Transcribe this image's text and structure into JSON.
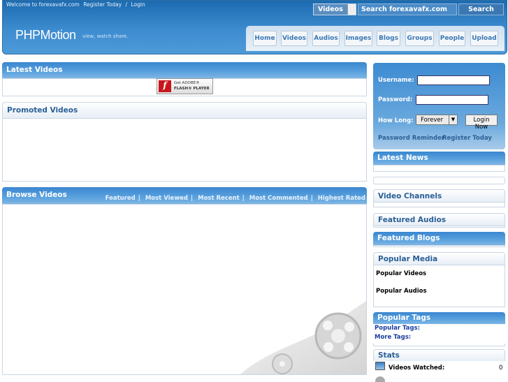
{
  "header": {
    "welcome": "Welcome to forexavafx.com",
    "register": "Register Today",
    "separator": "/",
    "login": "Login",
    "search_type": "Videos",
    "search_value": "Search forexavafx.com",
    "search_button": "Search",
    "logo": "PHPMotion",
    "logo_tagline": "view, watch share."
  },
  "nav": [
    "Home",
    "Videos",
    "Audios",
    "Images",
    "Blogs",
    "Groups",
    "People",
    "Upload"
  ],
  "main": {
    "latest_videos_title": "Latest Videos",
    "flash_line1": "Get ADOBE®",
    "flash_line2": "FLASH® PLAYER",
    "promoted_title": "Promoted Videos",
    "browse_title": "Browse Videos",
    "browse_links": [
      "Featured",
      "Most Viewed",
      "Most Recent",
      "Most Commented",
      "Highest Rated"
    ]
  },
  "login": {
    "username_label": "Username:",
    "password_label": "Password:",
    "how_long_label": "How Long:",
    "how_long_value": "Forever",
    "login_button": "Login Now",
    "password_reminder": "Password Reminder",
    "register": "Register Today"
  },
  "sidebar": {
    "latest_news": "Latest News",
    "video_channels": "Video Channels",
    "featured_audios": "Featured Audios",
    "featured_blogs": "Featured Blogs",
    "popular_media": "Popular Media",
    "popular_videos": "Popular Videos",
    "popular_audios": "Popular Audios",
    "popular_tags_title": "Popular Tags",
    "popular_tags_link": "Popular Tags:",
    "more_tags_link": "More Tags:",
    "stats_title": "Stats",
    "videos_watched_label": "Videos Watched:",
    "videos_watched_value": "0"
  }
}
